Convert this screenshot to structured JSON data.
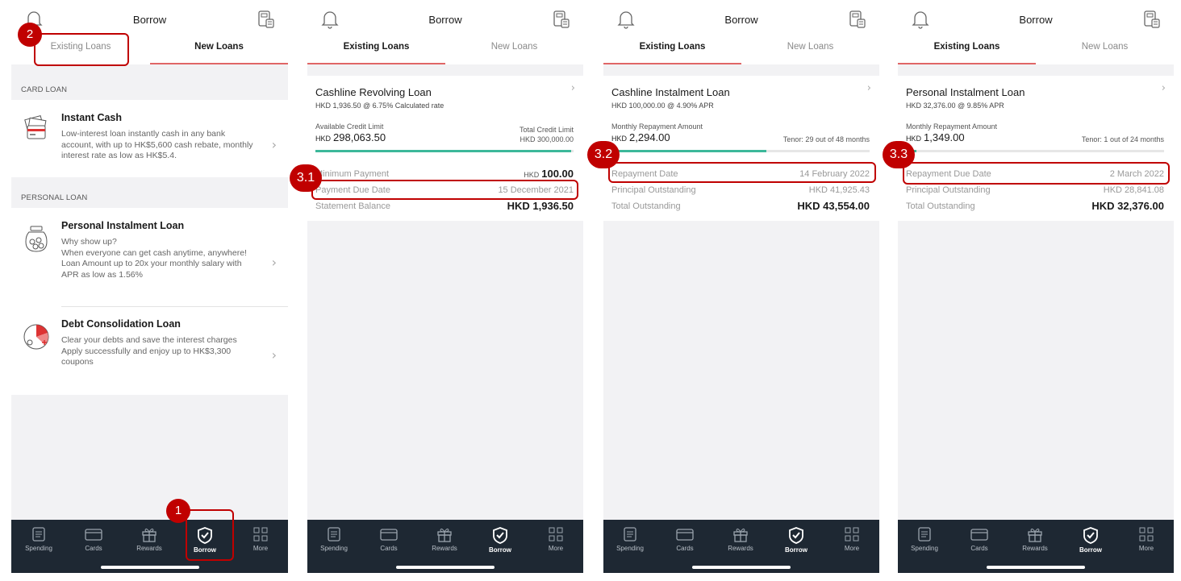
{
  "colors": {
    "accent": "#e06666",
    "annotation": "#c00000",
    "progress": "#3cb89a",
    "nav_bg": "#1e2833"
  },
  "header": {
    "title": "Borrow",
    "left_icon": "bell-icon",
    "right_icon": "calculator-icon"
  },
  "tabs": {
    "existing": "Existing Loans",
    "new": "New Loans"
  },
  "nav": [
    {
      "label": "Spending",
      "icon": "spending-icon"
    },
    {
      "label": "Cards",
      "icon": "card-icon"
    },
    {
      "label": "Rewards",
      "icon": "gift-icon"
    },
    {
      "label": "Borrow",
      "icon": "borrow-icon"
    },
    {
      "label": "More",
      "icon": "grid-icon"
    }
  ],
  "screen1": {
    "card_loan_section": "CARD LOAN",
    "personal_loan_section": "PERSONAL LOAN",
    "items": [
      {
        "title": "Instant Cash",
        "desc": "Low-interest loan instantly cash in any bank account, with up to HK$5,600 cash rebate, monthly interest rate as low as HK$5.4."
      },
      {
        "title": "Personal Instalment Loan",
        "desc": "Why show up?\nWhen everyone can get cash anytime, anywhere!\nLoan Amount up to 20x your monthly salary with APR as low as 1.56%"
      },
      {
        "title": "Debt Consolidation Loan",
        "desc": "Clear your debts and save the interest charges\nApply successfully and enjoy up to HK$3,300 coupons"
      }
    ]
  },
  "loans": [
    {
      "title": "Cashline Revolving Loan",
      "sub": "HKD  1,936.50 @ 6.75% Calculated rate",
      "left_label": "Available Credit Limit",
      "left_cur": "HKD",
      "left_value": "298,063.50",
      "right_label": "Total Credit Limit",
      "right_value": "HKD 300,000.00",
      "progress": 0.99,
      "rows": [
        {
          "label": "Minimum Payment",
          "cur": "HKD",
          "value": "100.00",
          "bold": true
        },
        {
          "label": "Payment Due Date",
          "cur": "",
          "value": "15 December 2021",
          "bold": false
        },
        {
          "label": "Statement Balance",
          "cur": "",
          "value": "HKD 1,936.50",
          "bold": true
        }
      ]
    },
    {
      "title": "Cashline Instalment Loan",
      "sub": "HKD 100,000.00 @ 4.90% APR",
      "left_label": "Monthly Repayment Amount",
      "left_cur": "HKD",
      "left_value": "2,294.00",
      "right_label": "",
      "right_value": "Tenor: 29 out of 48 months",
      "progress": 0.6,
      "rows": [
        {
          "label": "Repayment Date",
          "cur": "",
          "value": "14 February 2022",
          "bold": false
        },
        {
          "label": "Principal Outstanding",
          "cur": "",
          "value": "HKD 41,925.43",
          "bold": false
        },
        {
          "label": "Total Outstanding",
          "cur": "",
          "value": "HKD 43,554.00",
          "bold": true
        }
      ]
    },
    {
      "title": "Personal Instalment Loan",
      "sub": "HKD 32,376.00 @ 9.85% APR",
      "left_label": "Monthly Repayment Amount",
      "left_cur": "HKD",
      "left_value": "1,349.00",
      "right_label": "",
      "right_value": "Tenor: 1 out of 24 months",
      "progress": 0.04,
      "rows": [
        {
          "label": "Repayment Due Date",
          "cur": "",
          "value": "2 March 2022",
          "bold": false
        },
        {
          "label": "Principal Outstanding",
          "cur": "",
          "value": "HKD 28,841.08",
          "bold": false
        },
        {
          "label": "Total Outstanding",
          "cur": "",
          "value": "HKD 32,376.00",
          "bold": true
        }
      ]
    }
  ],
  "steps": {
    "s1": "1",
    "s2": "2",
    "s31": "3.1",
    "s32": "3.2",
    "s33": "3.3"
  }
}
